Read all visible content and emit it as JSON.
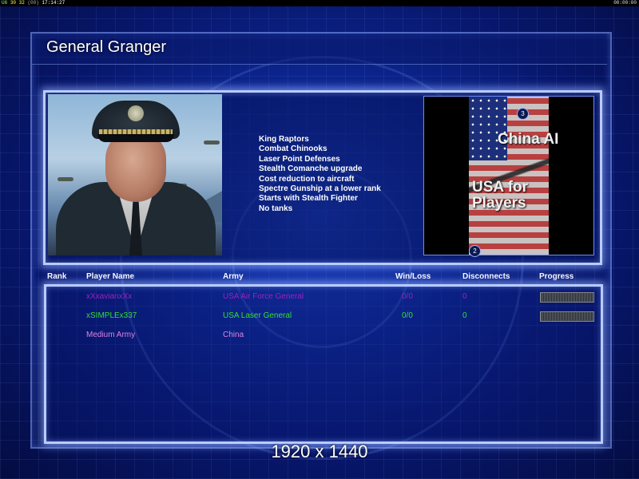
{
  "topbar": {
    "fps_a": "U6",
    "fps_b": "30",
    "fps_c": "32",
    "fps_d": "(00)",
    "clock": "17:14:27",
    "right_clock": "00:00:00"
  },
  "title": "General Granger",
  "traits": [
    "King Raptors",
    "Combat Chinooks",
    "Laser Point Defenses",
    "Stealth Comanche upgrade",
    "Cost reduction to aircraft",
    "Spectre Gunship at a lower rank",
    "Starts with Stealth Fighter",
    "No tanks"
  ],
  "map": {
    "label_line1": "China AI",
    "label_line2": "USA for",
    "label_line3": "Players",
    "marker_top": "3",
    "marker_bottom": "2"
  },
  "table": {
    "headers": [
      "Rank",
      "Player Name",
      "Army",
      "Win/Loss",
      "Disconnects",
      "Progress"
    ],
    "rows": [
      {
        "rank": "",
        "name": "xXxavianxXx",
        "army": "USA Air Force General",
        "winloss": "0/0",
        "disconnects": "0",
        "progress": true,
        "color": "#a020c0"
      },
      {
        "rank": "",
        "name": "xSIMPLEx337",
        "army": "USA Laser General",
        "winloss": "0/0",
        "disconnects": "0",
        "progress": true,
        "color": "#30e030"
      },
      {
        "rank": "",
        "name": "Medium Army",
        "army": "China",
        "winloss": "",
        "disconnects": "",
        "progress": false,
        "color": "#e080e0"
      }
    ]
  },
  "resolution_text": "1920 x 1440"
}
